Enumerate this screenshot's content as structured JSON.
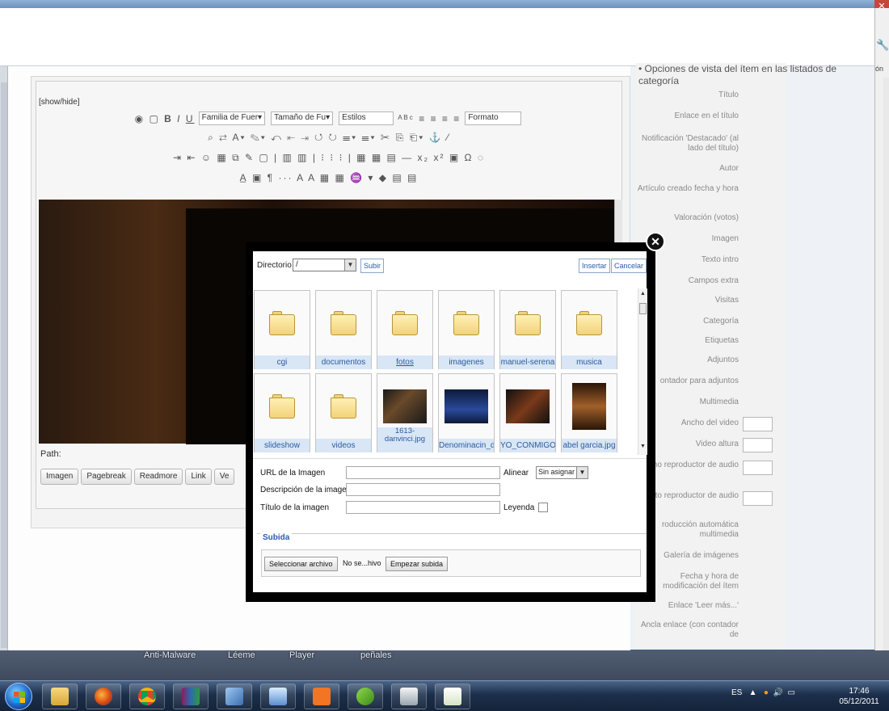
{
  "desktop": {
    "labels": [
      "Anti-Malware",
      "Léeme",
      "Player",
      "peñales"
    ]
  },
  "editor": {
    "show_hide": "[show/hide]",
    "toolbar": {
      "font_family": "Familia de Fuer▾",
      "font_size": "Tamaño de Fu▾",
      "styles": "Estilos",
      "format": "Formato"
    },
    "path_label": "Path:",
    "buttons": [
      "Imagen",
      "Pagebreak",
      "Readmore",
      "Link",
      "Ve"
    ]
  },
  "sidebar": {
    "heading": "• Opciones de vista del ítem en las listados de categoría",
    "rows": [
      "Título",
      "Enlace en el título",
      "Notificación 'Destacado' (al lado del título)",
      "Autor",
      "Artículo creado fecha y hora",
      "Valoración (votos)",
      "Imagen",
      "Texto intro",
      "Campos extra",
      "Visitas",
      "Categoría",
      "Etiquetas",
      "Adjuntos",
      "ontador para adjuntos",
      "Multimedia",
      "Ancho del video",
      "Video altura",
      "Ancho reproductor de audio",
      "Alto reproductor de audio",
      "roducción automática multimedia",
      "Galería de imágenes",
      "Fecha y hora de modificación del ítem",
      "Enlace 'Leer más...'",
      "Ancla enlace (con contador de"
    ],
    "strip_text": "ón"
  },
  "modal": {
    "close_symbol": "✕",
    "directory_label": "Directorio",
    "directory_value": "/",
    "upload_btn": "Subir",
    "insert_btn": "Insertar",
    "cancel_btn": "Cancelar",
    "files": [
      {
        "name": "cgi",
        "kind": "folder"
      },
      {
        "name": "documentos",
        "kind": "folder"
      },
      {
        "name": "fotos",
        "kind": "folder"
      },
      {
        "name": "imagenes",
        "kind": "folder"
      },
      {
        "name": "manuel-serena",
        "kind": "folder"
      },
      {
        "name": "musica",
        "kind": "folder"
      },
      {
        "name": "slideshow",
        "kind": "folder"
      },
      {
        "name": "videos",
        "kind": "folder"
      },
      {
        "name": "1613-danvinci.jpg",
        "kind": "image"
      },
      {
        "name": "Denominacin_de",
        "kind": "image"
      },
      {
        "name": "YO_CONMIGO_I",
        "kind": "image"
      },
      {
        "name": "abel garcia.jpg",
        "kind": "image"
      }
    ],
    "form": {
      "url_label": "URL de la Imagen",
      "desc_label": "Descripción de la imagen",
      "title_label": "Título de la imagen",
      "align_label": "Alinear",
      "align_value": "Sin asignar",
      "caption_label": "Leyenda"
    },
    "upload": {
      "legend": "Subida",
      "choose_btn": "Seleccionar archivo",
      "no_file": "No se...hivo",
      "start_btn": "Empezar subida"
    }
  },
  "taskbar": {
    "language": "ES",
    "time": "17:46",
    "date": "05/12/2011"
  },
  "colors": {
    "accent": "#2a5ca8",
    "tile_label_bg": "#d8e6f5"
  }
}
